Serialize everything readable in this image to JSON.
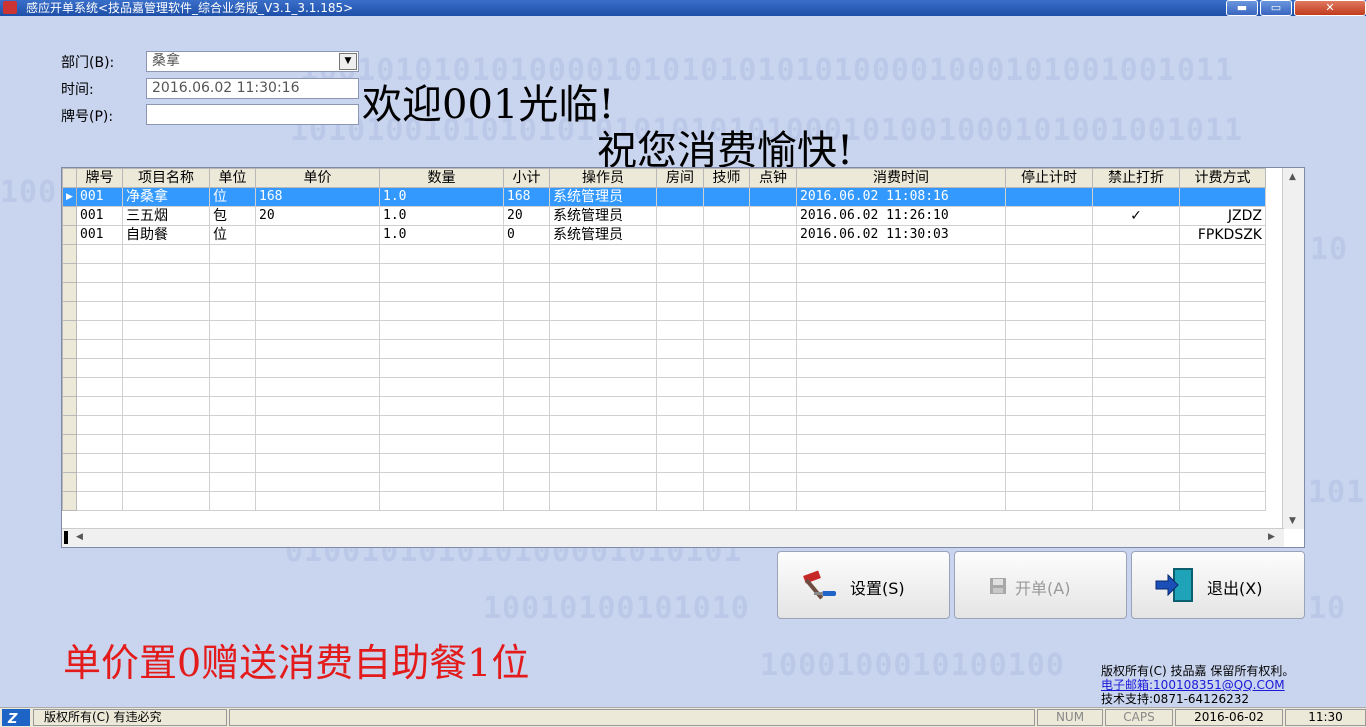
{
  "window": {
    "title": "感应开单系统<技品嘉管理软件_综合业务版_V3.1_3.1.185>",
    "minimize_glyph": "▬",
    "maximize_glyph": "▭",
    "close_glyph": "✕"
  },
  "background_digits": [
    "1001010101010000101010101010100001000101001001011",
    "10101001010101010101010101000101001000101001001011",
    "100",
    "10",
    "101",
    "010010101010100001010101",
    "10010100101010",
    "10",
    "1000100010100100"
  ],
  "form": {
    "department_label": "部门(B):",
    "department_value": "桑拿",
    "time_label": "时间:",
    "time_value": "2016.06.02 11:30:16",
    "tag_label": "牌号(P):",
    "tag_value": ""
  },
  "welcome": {
    "line1": "欢迎001光临!",
    "line2": "祝您消费愉快!"
  },
  "table": {
    "headers": [
      "牌号",
      "项目名称",
      "单位",
      "单价",
      "数量",
      "小计",
      "操作员",
      "房间",
      "技师",
      "点钟",
      "消费时间",
      "停止计时",
      "禁止打折",
      "计费方式"
    ],
    "rows": [
      {
        "selected": true,
        "cells": [
          "001",
          "净桑拿",
          "位",
          "168",
          "1.0",
          "168",
          "系统管理员",
          "",
          "",
          "",
          "2016.06.02 11:08:16",
          "",
          "",
          ""
        ]
      },
      {
        "selected": false,
        "cells": [
          "001",
          "三五烟",
          "包",
          "20",
          "1.0",
          "20",
          "系统管理员",
          "",
          "",
          "",
          "2016.06.02 11:26:10",
          "",
          "✓",
          "JZDZ"
        ]
      },
      {
        "selected": false,
        "cells": [
          "001",
          "自助餐",
          "位",
          "",
          "1.0",
          "0",
          "系统管理员",
          "",
          "",
          "",
          "2016.06.02 11:30:03",
          "",
          "",
          "FPKDSZK"
        ]
      }
    ],
    "row_pointer": "▶",
    "scroll_up": "▲",
    "scroll_down": "▼",
    "scroll_left": "◀",
    "scroll_right": "▶"
  },
  "buttons": {
    "settings_label": "设置(S)",
    "open_label": "开单(A)",
    "exit_label": "退出(X)"
  },
  "promo_text": "单价置0赠送消费自助餐1位",
  "copyright": {
    "line1": "版权所有(C) 技品嘉 保留所有权利。",
    "email": "电子邮箱:100108351@QQ.COM",
    "support": "技术支持:0871-64126232"
  },
  "statusbar": {
    "text": "版权所有(C) 有违必究",
    "num": "NUM",
    "caps": "CAPS",
    "date": "2016-06-02",
    "time": "11:30"
  },
  "colors": {
    "background": "#c9d4ef",
    "selection": "#3399ff",
    "promo": "#e31b1b",
    "titlebar": "#1e4fa8"
  },
  "icons": {
    "settings": "hammer-screwdriver-icon",
    "open": "floppy-disk-icon",
    "exit": "exit-door-icon",
    "app": "app-icon"
  }
}
